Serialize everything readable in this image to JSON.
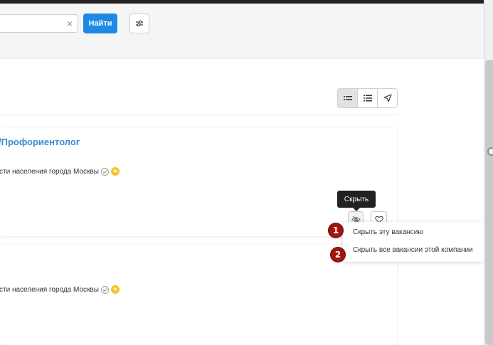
{
  "search": {
    "input_value": "",
    "clear_icon": "×",
    "submit_label": "Найти",
    "filter_icon": "sliders-icon"
  },
  "view_switcher": {
    "items": [
      "list-compact-icon",
      "list-icon",
      "map-pin-icon"
    ],
    "active": 0
  },
  "vacancies": [
    {
      "title": "/Профориентолог",
      "company": "сти населения города Москвы",
      "badges": [
        "verified-icon",
        "star-badge-icon"
      ]
    },
    {
      "title": "",
      "company": "сти населения города Москвы",
      "badges": [
        "verified-icon",
        "star-badge-icon"
      ]
    }
  ],
  "actions": {
    "hide_icon": "eye-off-icon",
    "favorite_icon": "heart-icon"
  },
  "tooltip": {
    "text": "Скрыть"
  },
  "hide_menu": {
    "items": [
      {
        "label": "Скрыть эту вакансию",
        "marker": "1"
      },
      {
        "label": "Скрыть все вакансии этой компании",
        "marker": "2"
      }
    ]
  },
  "colors": {
    "accent": "#1e88e5",
    "title_link": "#3a8ad0",
    "marker": "#a5130f",
    "tooltip_bg": "#222222",
    "star": "#f4c52a"
  }
}
